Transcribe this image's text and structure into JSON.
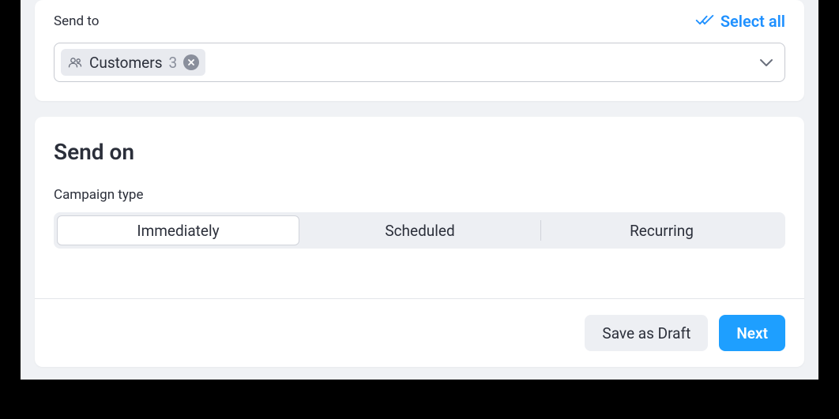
{
  "send_to": {
    "label": "Send to",
    "select_all": "Select all",
    "tag": {
      "name": "Customers",
      "count": "3"
    }
  },
  "send_on": {
    "title": "Send on",
    "campaign_type_label": "Campaign type",
    "options": {
      "immediately": "Immediately",
      "scheduled": "Scheduled",
      "recurring": "Recurring"
    }
  },
  "actions": {
    "save_draft": "Save as Draft",
    "next": "Next"
  }
}
